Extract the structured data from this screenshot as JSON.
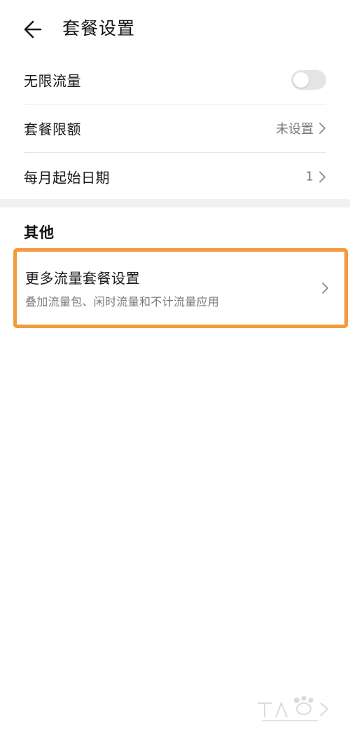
{
  "header": {
    "title": "套餐设置",
    "back_icon": "arrow-left-icon"
  },
  "settings": {
    "unlimited_data": {
      "label": "无限流量",
      "enabled": false
    },
    "plan_limit": {
      "label": "套餐限额",
      "value": "未设置"
    },
    "monthly_start_date": {
      "label": "每月起始日期",
      "value": "1"
    }
  },
  "others": {
    "section_title": "其他",
    "more_plan_settings": {
      "title": "更多流量套餐设置",
      "subtitle": "叠加流量包、闲时流量和不计流量应用"
    }
  },
  "colors": {
    "highlight": "#f39a3c",
    "toggle_off": "#e4e4e4",
    "secondary_text": "#7a7a7a",
    "divider": "#e6e6e6"
  }
}
